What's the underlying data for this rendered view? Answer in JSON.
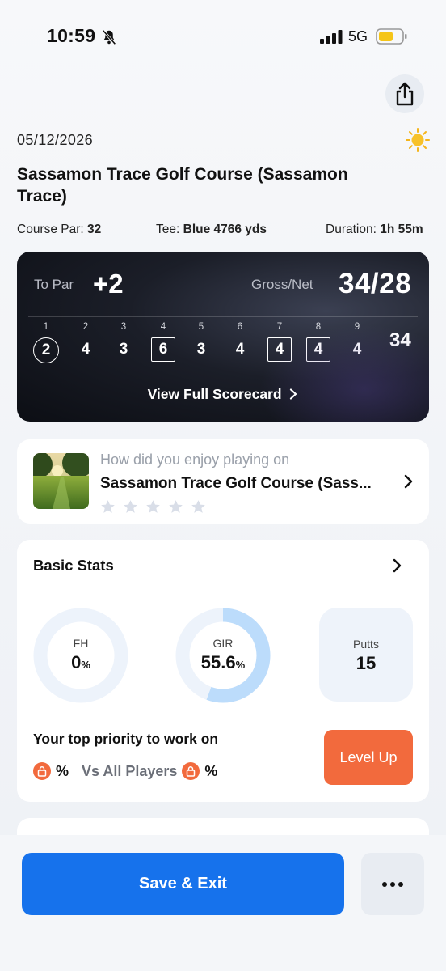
{
  "status_bar": {
    "time": "10:59",
    "network": "5G",
    "battery_color": "#f5c518"
  },
  "header": {
    "date": "05/12/2026",
    "weather_icon": "sun-icon"
  },
  "course": {
    "name": "Sassamon Trace Golf Course (Sassamon Trace)",
    "par_label": "Course Par:",
    "par_value": "32",
    "tee_label": "Tee:",
    "tee_value": "Blue 4766 yds",
    "duration_label": "Duration:",
    "duration_value": "1h 55m"
  },
  "scorecard": {
    "to_par_label": "To Par",
    "to_par_value": "+2",
    "gross_net_label": "Gross/Net",
    "gross_net_value": "34/28",
    "holes": [
      {
        "hole": "1",
        "score": "2",
        "style": "circle"
      },
      {
        "hole": "2",
        "score": "4",
        "style": "plain"
      },
      {
        "hole": "3",
        "score": "3",
        "style": "plain"
      },
      {
        "hole": "4",
        "score": "6",
        "style": "square"
      },
      {
        "hole": "5",
        "score": "3",
        "style": "plain"
      },
      {
        "hole": "6",
        "score": "4",
        "style": "plain"
      },
      {
        "hole": "7",
        "score": "4",
        "style": "square"
      },
      {
        "hole": "8",
        "score": "4",
        "style": "square"
      },
      {
        "hole": "9",
        "score": "4",
        "style": "plain"
      }
    ],
    "total": "34",
    "view_full_label": "View Full Scorecard"
  },
  "rating": {
    "question": "How did you enjoy playing on",
    "course_name": "Sassamon Trace Golf Course (Sass...",
    "stars": 0
  },
  "basic_stats": {
    "title": "Basic Stats",
    "fh": {
      "label": "FH",
      "value": "0",
      "unit": "%",
      "fraction": 0
    },
    "gir": {
      "label": "GIR",
      "value": "55.6",
      "unit": "%",
      "fraction": 0.556
    },
    "putts": {
      "label": "Putts",
      "value": "15"
    },
    "priority_label": "Your top priority to work on",
    "pct_symbol_1": "%",
    "vs_label": "Vs All Players",
    "pct_symbol_2": "%",
    "level_up_label": "Level Up"
  },
  "footer": {
    "save_exit_label": "Save & Exit"
  },
  "colors": {
    "primary": "#1672ec",
    "accent": "#f26a3d",
    "ring_fill": "#bcdcfb",
    "ring_track": "#edf3fb"
  }
}
